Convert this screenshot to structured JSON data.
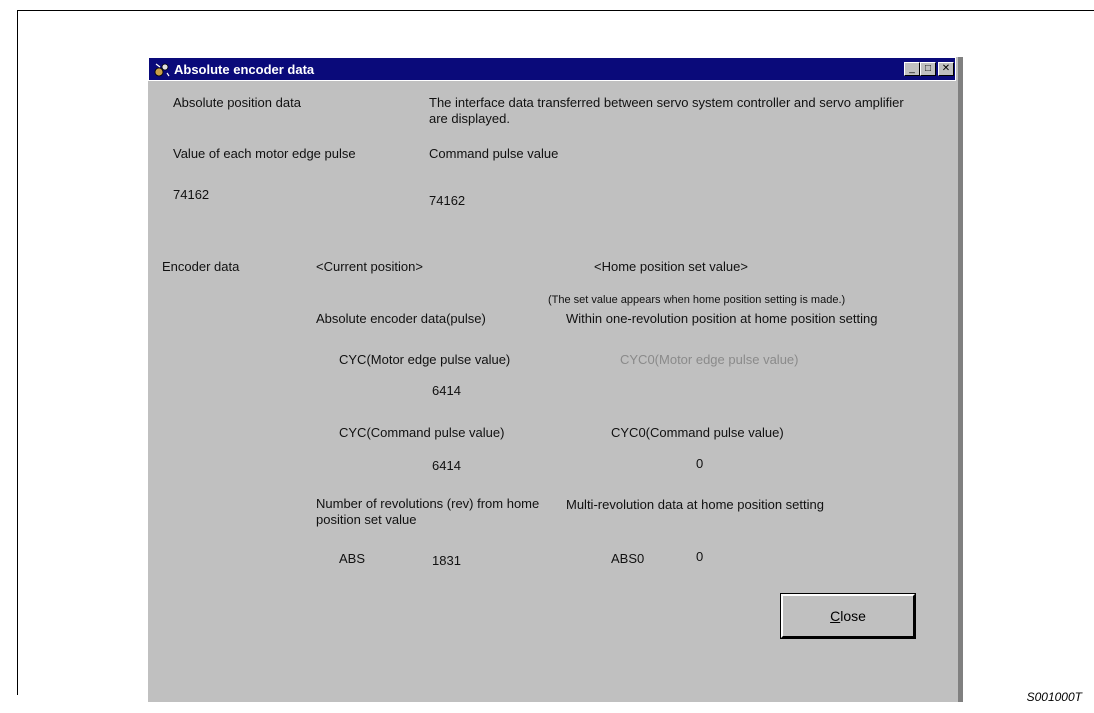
{
  "window": {
    "title": "Absolute encoder data",
    "minimize_glyph": "_",
    "maximize_glyph": "□",
    "close_glyph": "✕"
  },
  "top": {
    "abs_position_label": "Absolute position data",
    "interface_desc": "The interface data transferred between servo system controller and servo amplifier are displayed.",
    "motor_edge_label": "Value of each motor edge pulse",
    "command_pulse_label": "Command pulse value",
    "motor_edge_value": "74162",
    "command_pulse_value": "74162"
  },
  "encoder": {
    "section_label": "Encoder data",
    "current_position_header": "<Current position>",
    "home_position_header": "<Home position set value>",
    "home_note": "(The set value appears when home position setting is made.)",
    "abs_encoder_label": "Absolute encoder data(pulse)",
    "within_rev_label": "Within one-revolution position at home position setting",
    "cyc_motor_label": "CYC(Motor edge pulse value)",
    "cyc0_motor_label": "CYC0(Motor edge pulse value)",
    "cyc_motor_value": "6414",
    "cyc_command_label": "CYC(Command pulse value)",
    "cyc0_command_label": "CYC0(Command pulse value)",
    "cyc_command_value": "6414",
    "cyc0_command_value": "0",
    "revolutions_label": "Number of revolutions (rev) from home position set value",
    "multi_rev_label": "Multi-revolution data at home position setting",
    "abs_label": "ABS",
    "abs_value": "1831",
    "abs0_label": "ABS0",
    "abs0_value": "0"
  },
  "buttons": {
    "close_mnemonic": "C",
    "close_rest": "lose"
  },
  "caption": "S001000T"
}
